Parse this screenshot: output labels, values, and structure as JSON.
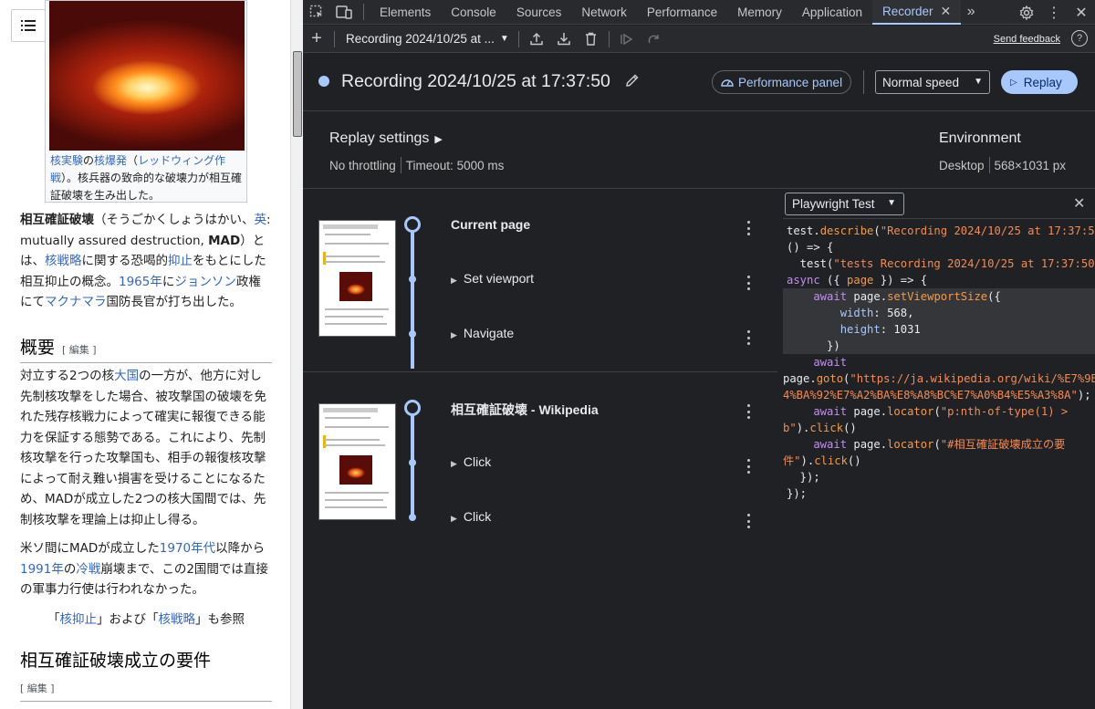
{
  "wiki": {
    "figure_caption_parts": [
      "核実験",
      "の",
      "核爆発",
      "（",
      "レッドウィング作戦",
      "）。核兵器の致命的な破壊力が相互確証破壊を生み出した。"
    ],
    "intro": {
      "term": "相互確証破壊",
      "reading": "（そうごかくしょうはかい、",
      "lang": "英",
      "english": ": mutually assured destruction, ",
      "abbr": "MAD",
      "after_abbr": "）とは、",
      "link1": "核戦略",
      "t1": "に関する恐喝的",
      "link2": "抑止",
      "t2": "をもとにした相互抑止の概念。",
      "link3": "1965年",
      "t3": "に",
      "link4": "ジョンソン",
      "t4": "政権にて",
      "link5": "マクナマラ",
      "t5": "国防長官が打ち出した。"
    },
    "h_overview": "概要",
    "edit_label": "[ 編集 ]",
    "p_overview_a": "対立する2つの核",
    "p_overview_link": "大国",
    "p_overview_b": "の一方が、他方に対し先制核攻撃をした場合、被攻撃国の破壊を免れた残存核戦力によって確実に報復できる能力を保証する態勢である。これにより、先制核攻撃を行った攻撃国も、相手の報復核攻撃によって耐え難い損害を受けることになるため、MADが成立した2つの核大国間では、先制核攻撃を理論上は抑止し得る。",
    "p2_a": "米ソ間にMADが成立した",
    "p2_link1": "1970年代",
    "p2_b": "以降から",
    "p2_link2": "1991年",
    "p2_c": "の",
    "p2_link3": "冷戦",
    "p2_d": "崩壊まで、この2国間では直接の軍事力行使は行われなかった。",
    "see_also_a": "「",
    "see_also_link1": "核抑止",
    "see_also_b": "」および「",
    "see_also_link2": "核戦略",
    "see_also_c": "」も参照",
    "h_requirements": "相互確証破壊成立の要件"
  },
  "devtools": {
    "tabs": [
      "Elements",
      "Console",
      "Sources",
      "Network",
      "Performance",
      "Memory",
      "Application",
      "Recorder"
    ],
    "active_tab": "Recorder",
    "toolbar": {
      "recording_select": "Recording 2024/10/25 at ...",
      "send_feedback": "Send feedback",
      "help": "?"
    },
    "header": {
      "title": "Recording 2024/10/25 at 17:37:50",
      "performance_panel": "Performance panel",
      "speed": "Normal speed",
      "replay": "Replay"
    },
    "settings": {
      "title": "Replay settings",
      "throttling": "No throttling",
      "timeout": "Timeout: 5000 ms",
      "env_title": "Environment",
      "device": "Desktop",
      "viewport": "568×1031 px"
    },
    "sections": [
      {
        "title": "Current page",
        "steps": [
          "Set viewport",
          "Navigate"
        ]
      },
      {
        "title": "相互確証破壊 - Wikipedia",
        "steps": [
          "Click",
          "Click"
        ]
      }
    ],
    "code_lang": "Playwright Test",
    "code": {
      "l1_a": "test.",
      "l1_fn": "describe",
      "l1_str": "\"Recording 2024/10/25 at 17:37:50\"",
      "l1_end": ",",
      "l2": "() => {",
      "l3_a": "  test(",
      "l3_str": "\"tests Recording 2024/10/25 at 17:37:50\"",
      "l3_end": ",",
      "l4_kw": "async",
      "l4_a": " ({ ",
      "l4_page": "page",
      "l4_b": " }) => {",
      "l5_kw": "    await",
      "l5_a": " page.",
      "l5_fn": "setViewportSize",
      "l5_b": "({",
      "l6_prop": "        width",
      "l6_v": ": 568,",
      "l7_prop": "        height",
      "l7_v": ": 1031",
      "l8": "      })",
      "l9_kw": "    await",
      "l10_a": "page.",
      "l10_fn": "goto",
      "l10_b": "(",
      "l10_str": "\"https://ja.wikipedia.org/wiki/%E7%9B%B8%E",
      "l11_str": "4%BA%92%E7%A2%BA%E8%A8%BC%E7%A0%B4%E5%A3%8A\"",
      "l11_b": ");",
      "l12_kw": "    await",
      "l12_a": " page.",
      "l12_fn": "locator",
      "l12_b": "(",
      "l12_str": "\"p:nth-of-type(1) >",
      "l13_str": "b\"",
      "l13_a": ").",
      "l13_fn": "click",
      "l13_b": "()",
      "l14_kw": "    await",
      "l14_a": " page.",
      "l14_fn": "locator",
      "l14_b": "(",
      "l14_str": "\"#相互確証破壊成立の要",
      "l15_str": "件\"",
      "l15_a": ").",
      "l15_fn": "click",
      "l15_b": "()",
      "l16": "  });",
      "l17": "});"
    }
  }
}
